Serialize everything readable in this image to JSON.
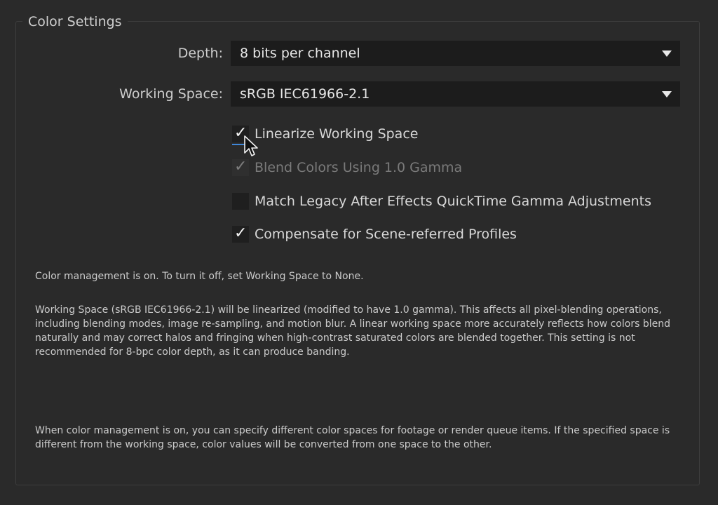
{
  "group": {
    "title": "Color Settings"
  },
  "depth": {
    "label": "Depth:",
    "value": "8 bits per channel"
  },
  "working_space": {
    "label": "Working Space:",
    "value": "sRGB IEC61966-2.1"
  },
  "options": [
    {
      "label": "Linearize Working Space",
      "checked": true,
      "enabled": true
    },
    {
      "label": "Blend Colors Using 1.0 Gamma",
      "checked": true,
      "enabled": false
    },
    {
      "label": "Match Legacy After Effects QuickTime Gamma Adjustments",
      "checked": false,
      "enabled": true
    },
    {
      "label": "Compensate for Scene-referred Profiles",
      "checked": true,
      "enabled": true
    }
  ],
  "info": {
    "status": "Color management is on. To turn it off, set Working Space to None.",
    "linearize_note": "Working Space (sRGB IEC61966-2.1) will be linearized (modified to have 1.0 gamma). This affects all pixel-blending operations, including blending modes, image re-sampling, and motion blur. A linear working space more accurately reflects how colors blend naturally and may correct halos and fringing when high-contrast saturated colors are blended together. This setting is not recommended for 8-bpc color depth, as it can produce banding.",
    "management_note": "When color management is on, you can specify different color spaces for footage or render queue items. If the specified space is different from the working space, color values will be converted from one space to the other."
  },
  "icons": {
    "check": "✓",
    "dropdown": "chevron-down-icon",
    "cursor": "mouse-pointer-icon"
  },
  "colors": {
    "background": "#2a2a2a",
    "field": "#1c1c1c",
    "focus": "#3f86d8"
  }
}
